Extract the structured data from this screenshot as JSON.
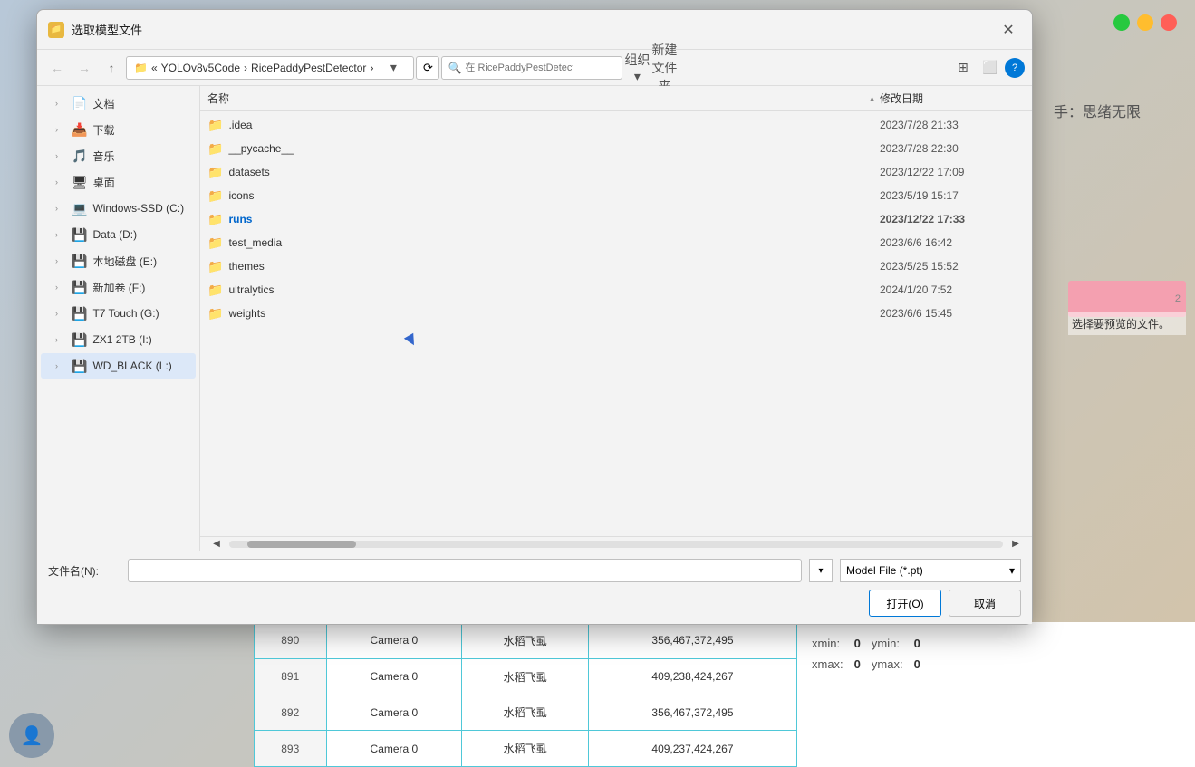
{
  "background": {
    "hint_text": "手：思绪无限"
  },
  "traffic_lights": {
    "green": "#27c93f",
    "yellow": "#ffbd2e",
    "red": "#ff5f57"
  },
  "dialog": {
    "title": "选取模型文件",
    "close_label": "✕",
    "toolbar": {
      "back_label": "←",
      "forward_label": "→",
      "up_label": "↑"
    },
    "address": {
      "root": "YOLOv8v5Code",
      "sep1": "›",
      "folder": "RicePaddyPestDetector",
      "sep2": "›",
      "dropdown_label": "▾",
      "refresh_label": "⟳",
      "search_placeholder": "在 RicePaddyPestDetector ..."
    },
    "organize_label": "组织 ▾",
    "new_folder_label": "新建文件夹",
    "view_options_label": "⊞",
    "preview_label": "⬜",
    "help_label": "?",
    "sidebar": {
      "items": [
        {
          "id": "documents",
          "label": "文档",
          "icon": "📄",
          "has_chevron": true
        },
        {
          "id": "downloads",
          "label": "下载",
          "icon": "📥",
          "has_chevron": true
        },
        {
          "id": "music",
          "label": "音乐",
          "icon": "🎵",
          "has_chevron": true
        },
        {
          "id": "desktop",
          "label": "桌面",
          "icon": "🖥",
          "has_chevron": true
        },
        {
          "id": "windows-ssd",
          "label": "Windows-SSD (C:)",
          "icon": "💻",
          "has_chevron": true
        },
        {
          "id": "data-d",
          "label": "Data (D:)",
          "icon": "💾",
          "has_chevron": true
        },
        {
          "id": "local-e",
          "label": "本地磁盘 (E:)",
          "icon": "💾",
          "has_chevron": true
        },
        {
          "id": "new-vol-f",
          "label": "新加卷 (F:)",
          "icon": "💾",
          "has_chevron": true
        },
        {
          "id": "t7-g",
          "label": "T7 Touch (G:)",
          "icon": "💾",
          "has_chevron": true
        },
        {
          "id": "zx1-i",
          "label": "ZX1 2TB (I:)",
          "icon": "💾",
          "has_chevron": true
        },
        {
          "id": "wd-l",
          "label": "WD_BLACK (L:)",
          "icon": "💾",
          "has_chevron": true,
          "selected": true
        }
      ]
    },
    "columns": {
      "name": "名称",
      "date": "修改日期"
    },
    "files": [
      {
        "id": "idea",
        "name": ".idea",
        "date": "2023/7/28 21:33",
        "type": "folder"
      },
      {
        "id": "pycache",
        "name": "__pycache__",
        "date": "2023/7/28 22:30",
        "type": "folder"
      },
      {
        "id": "datasets",
        "name": "datasets",
        "date": "2023/12/22 17:09",
        "type": "folder"
      },
      {
        "id": "icons",
        "name": "icons",
        "date": "2023/5/19 15:17",
        "type": "folder"
      },
      {
        "id": "runs",
        "name": "runs",
        "date": "2023/12/22 17:33",
        "type": "folder",
        "highlighted": true
      },
      {
        "id": "test_media",
        "name": "test_media",
        "date": "2023/6/6 16:42",
        "type": "folder"
      },
      {
        "id": "themes",
        "name": "themes",
        "date": "2023/5/25 15:52",
        "type": "folder"
      },
      {
        "id": "ultralytics",
        "name": "ultralytics",
        "date": "2024/1/20 7:52",
        "type": "folder"
      },
      {
        "id": "weights",
        "name": "weights",
        "date": "2023/6/6 15:45",
        "type": "folder"
      }
    ],
    "bottom": {
      "filename_label": "文件名(N):",
      "filename_value": "",
      "filetype_label": "Model File (*.pt)",
      "filetype_dropdown": "▾",
      "open_label": "打开(O)",
      "cancel_label": "取消"
    },
    "preview_panel": {
      "text": "选择要预览的文件。"
    }
  },
  "data_table": {
    "rows": [
      {
        "id": "890",
        "camera": "Camera 0",
        "label": "水稻飞虱",
        "coords": "356,467,372,495"
      },
      {
        "id": "891",
        "camera": "Camera 0",
        "label": "水稻飞虱",
        "coords": "409,238,424,267"
      },
      {
        "id": "892",
        "camera": "Camera 0",
        "label": "水稻飞虱",
        "coords": "356,467,372,495"
      },
      {
        "id": "893",
        "camera": "Camera 0",
        "label": "水稻飞虱",
        "coords": "409,237,424,267"
      }
    ],
    "coords_panel": {
      "xmin_label": "xmin:",
      "xmin_value": "0",
      "ymin_label": "ymin:",
      "ymin_value": "0",
      "xmax_label": "xmax:",
      "xmax_value": "0",
      "ymax_label": "ymax:",
      "ymax_value": "0"
    }
  }
}
